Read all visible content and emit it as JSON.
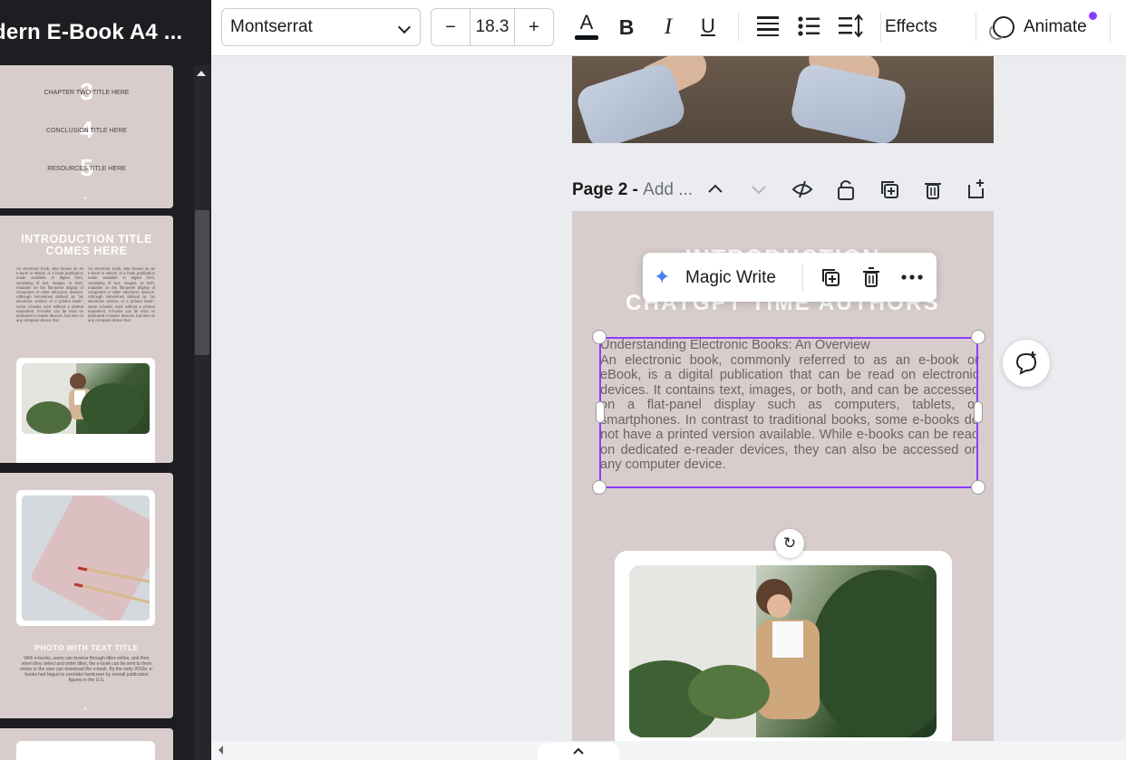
{
  "document": {
    "title": "dern E-Book A4 ..."
  },
  "sidebar": {
    "thumb1": {
      "items": [
        {
          "num": "3",
          "label": "CHAPTER TWO TITLE HERE"
        },
        {
          "num": "4",
          "label": "CONCLUSION TITLE HERE"
        },
        {
          "num": "5",
          "label": "RESOURCES TITLE HERE"
        }
      ]
    },
    "thumb2": {
      "title": "INTRODUCTION TITLE COMES HERE",
      "col_text": "An electronic book, also known as an e-book or eBook, is a book publication made available in digital form, consisting of text, images, or both, readable on the flat-panel display of computers or other electronic devices. Although sometimes defined as \"an electronic version of a printed book\", some e-books exist without a printed equivalent. E-books can be read on dedicated e-reader devices, but also on any computer device that"
    },
    "thumb3": {
      "title": "PHOTO WITH TEXT TITLE",
      "body": "With e-books, users can browse through titles online, and then when they select and order titles, the e-book can be sent to them online or the user can download the e-book. By the early 2010s, e-books had begun to overtake hardcover by overall publication figures in the U.S."
    },
    "plus": "+"
  },
  "toolbar": {
    "font": "Montserrat",
    "size_minus": "−",
    "font_size": "18.3",
    "size_plus": "+",
    "color_letter": "A",
    "bold": "B",
    "italic": "I",
    "underline": "U",
    "effects": "Effects",
    "animate": "Animate"
  },
  "page2": {
    "label_prefix": "Page 2 - ",
    "label_add": "Add ...",
    "title_line1": "INTRODUCTION",
    "title_line2": "CHATGPT TIME AUTHORS",
    "title_overlap": "5",
    "text": "Understanding Electronic Books: An Overview\nAn electronic book, commonly referred to as an e-book or eBook, is a digital publication that can be read on electronic devices. It contains text, images, or both, and can be accessed on a flat-panel display such as computers, tablets, or smartphones. In contrast to traditional books, some e-books do not have a printed version available. While e-books can be read on dedicated e-reader devices, they can also be accessed on any computer device."
  },
  "floating_bar": {
    "magic_write": "Magic Write"
  },
  "colors": {
    "accent": "#8b3dff",
    "page_bg": "#d8cdcc",
    "sidebar_bg": "#1d1e22"
  }
}
